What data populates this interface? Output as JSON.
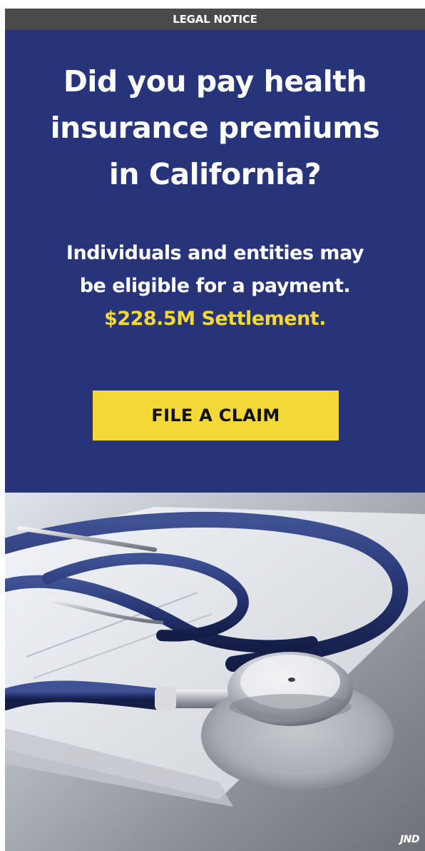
{
  "banner": {
    "label": "LEGAL NOTICE"
  },
  "headline": {
    "line1": "Did you pay health",
    "line2": "insurance premiums",
    "line3": "in California?"
  },
  "subline": {
    "line1": "Individuals and entities may",
    "line2": "be eligible for a payment.",
    "settlement": "$228.5M Settlement."
  },
  "cta": {
    "label": "FILE A CLAIM"
  },
  "logo": {
    "text": "JND"
  },
  "colors": {
    "panel_blue": "#283479",
    "accent_yellow": "#f3d838",
    "banner_gray": "#4a4a4a"
  },
  "image": {
    "subject": "stethoscope-photo"
  }
}
